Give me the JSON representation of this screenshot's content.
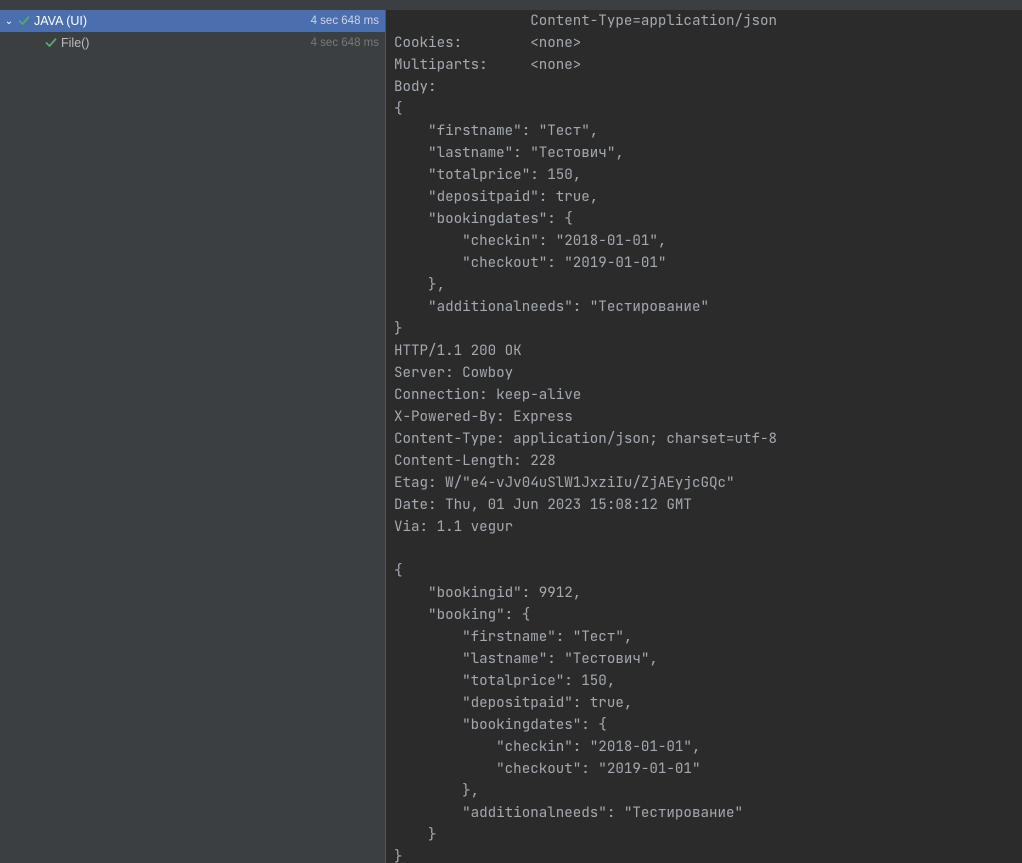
{
  "toolbar": {
    "icons": [
      "list-icon",
      "expand-icon",
      "collapse-icon",
      "filter-icon",
      "sort-icon",
      "settings-icon",
      "export-icon"
    ]
  },
  "tree": {
    "root": {
      "label": "JAVA (UI)",
      "time": "4 sec 648 ms",
      "status": "passed"
    },
    "child": {
      "label": "File()",
      "time": "4 sec 648 ms",
      "status": "passed"
    }
  },
  "console": {
    "lines": [
      "                Content-Type=application/json",
      "Cookies:        <none>",
      "Multiparts:     <none>",
      "Body:",
      "{",
      "    \"firstname\": \"Тест\",",
      "    \"lastname\": \"Тестович\",",
      "    \"totalprice\": 150,",
      "    \"depositpaid\": true,",
      "    \"bookingdates\": {",
      "        \"checkin\": \"2018-01-01\",",
      "        \"checkout\": \"2019-01-01\"",
      "    },",
      "    \"additionalneeds\": \"Тестирование\"",
      "}",
      "HTTP/1.1 200 OK",
      "Server: Cowboy",
      "Connection: keep-alive",
      "X-Powered-By: Express",
      "Content-Type: application/json; charset=utf-8",
      "Content-Length: 228",
      "Etag: W/\"e4-vJv04uSlW1JxziIu/ZjAEyjcGQc\"",
      "Date: Thu, 01 Jun 2023 15:08:12 GMT",
      "Via: 1.1 vegur",
      "",
      "{",
      "    \"bookingid\": 9912,",
      "    \"booking\": {",
      "        \"firstname\": \"Тест\",",
      "        \"lastname\": \"Тестович\",",
      "        \"totalprice\": 150,",
      "        \"depositpaid\": true,",
      "        \"bookingdates\": {",
      "            \"checkin\": \"2018-01-01\",",
      "            \"checkout\": \"2019-01-01\"",
      "        },",
      "        \"additionalneeds\": \"Тестирование\"",
      "    }",
      "}"
    ]
  }
}
